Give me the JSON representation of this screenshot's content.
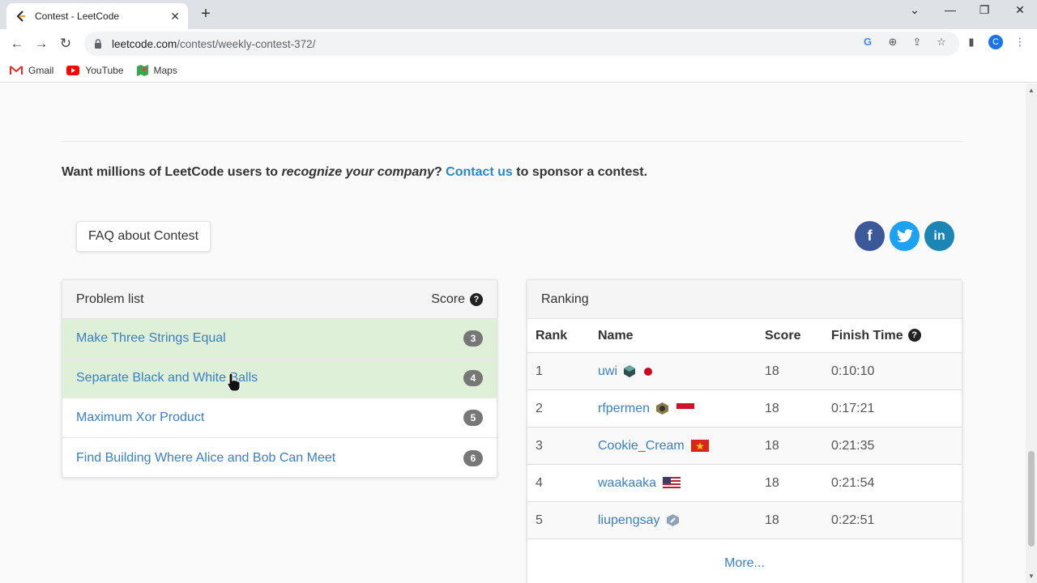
{
  "browser": {
    "tab_title": "Contest - LeetCode",
    "url_host": "leetcode.com",
    "url_path": "/contest/weekly-contest-372/",
    "bookmarks": [
      {
        "label": "Gmail",
        "icon": "gmail-icon"
      },
      {
        "label": "YouTube",
        "icon": "youtube-icon"
      },
      {
        "label": "Maps",
        "icon": "maps-icon"
      }
    ]
  },
  "sponsor": {
    "prefix": "Want millions of LeetCode users to ",
    "emphasis": "recognize your company",
    "question": "? ",
    "link": "Contact us",
    "suffix": " to sponsor a contest."
  },
  "faq_label": "FAQ about Contest",
  "social": [
    {
      "name": "facebook",
      "glyph": "f",
      "color": "#3b5998"
    },
    {
      "name": "twitter",
      "glyph": "t",
      "color": "#1da1f2"
    },
    {
      "name": "linkedin",
      "glyph": "in",
      "color": "#1b86b5"
    }
  ],
  "problems": {
    "header": "Problem list",
    "score_header": "Score",
    "help_glyph": "?",
    "items": [
      {
        "name": "Make Three Strings Equal",
        "score": "3",
        "solved": true
      },
      {
        "name": "Separate Black and White Balls",
        "score": "4",
        "solved": true
      },
      {
        "name": "Maximum Xor Product",
        "score": "5",
        "solved": false
      },
      {
        "name": "Find Building Where Alice and Bob Can Meet",
        "score": "6",
        "solved": false
      }
    ]
  },
  "ranking": {
    "header": "Ranking",
    "columns": {
      "rank": "Rank",
      "name": "Name",
      "score": "Score",
      "finish": "Finish Time"
    },
    "rows": [
      {
        "rank": "1",
        "name": "uwi",
        "score": "18",
        "time": "0:10:10",
        "badge": "cube-badge",
        "flag": "japan-flag"
      },
      {
        "rank": "2",
        "name": "rfpermen",
        "score": "18",
        "time": "0:17:21",
        "badge": "hex-badge",
        "flag": "indonesia-flag"
      },
      {
        "rank": "3",
        "name": "Cookie_Cream",
        "score": "18",
        "time": "0:21:35",
        "badge": "",
        "flag": "vietnam-flag"
      },
      {
        "rank": "4",
        "name": "waakaaka",
        "score": "18",
        "time": "0:21:54",
        "badge": "",
        "flag": "usa-flag"
      },
      {
        "rank": "5",
        "name": "liupengsay",
        "score": "18",
        "time": "0:22:51",
        "badge": "shield-badge",
        "flag": ""
      }
    ],
    "more": "More..."
  },
  "colors": {
    "link": "#3a7fc4",
    "solved_row": "#dff0d8",
    "badge": "#777777"
  }
}
